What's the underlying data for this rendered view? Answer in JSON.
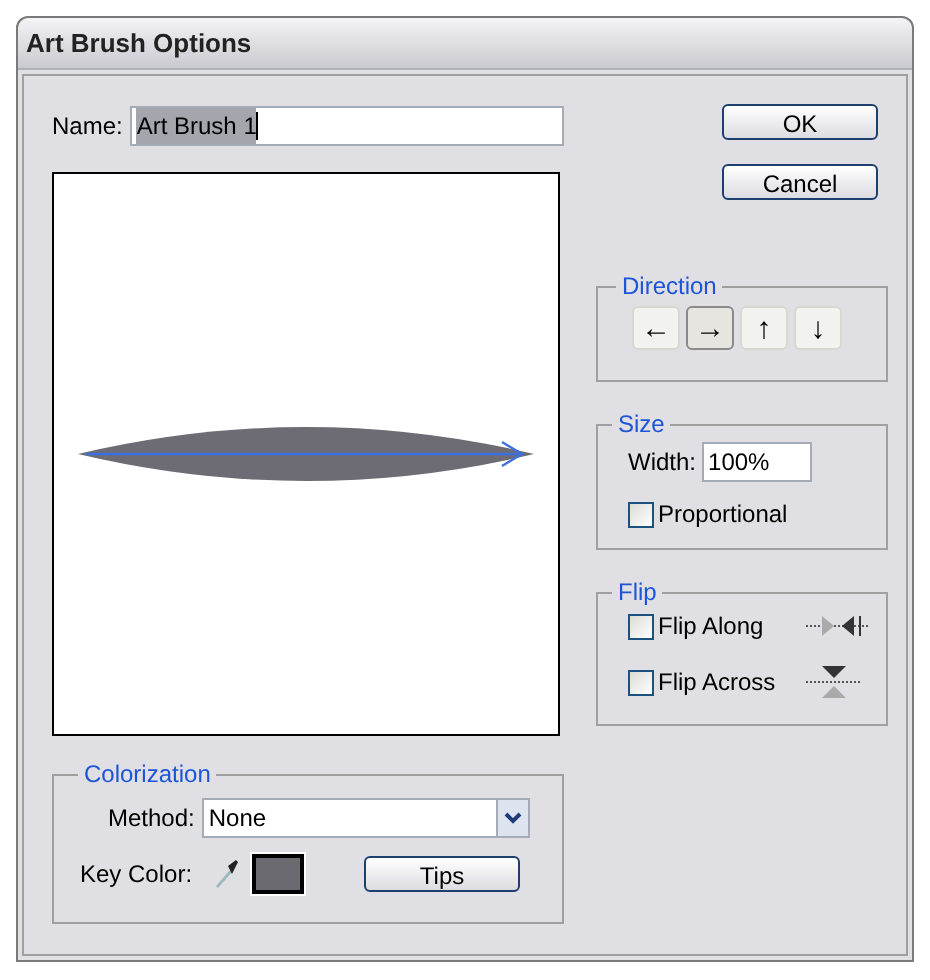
{
  "window": {
    "title": "Art Brush Options"
  },
  "name_field": {
    "label": "Name:",
    "value": "Art Brush 1"
  },
  "buttons": [
    {
      "label": "OK"
    },
    {
      "label": "Cancel"
    }
  ],
  "direction": {
    "title": "Direction",
    "buttons": [
      {
        "symbol": "←",
        "selected": false
      },
      {
        "symbol": "→",
        "selected": true
      },
      {
        "symbol": "↑",
        "selected": false
      },
      {
        "symbol": "↓",
        "selected": false
      }
    ]
  },
  "size": {
    "title": "Size",
    "width_label": "Width:",
    "width_value": "100%",
    "proportional": {
      "label": "Proportional",
      "checked": false
    }
  },
  "flip": {
    "title": "Flip",
    "options": [
      {
        "label": "Flip Along",
        "checked": false,
        "kind": "along"
      },
      {
        "label": "Flip Across",
        "checked": false,
        "kind": "across"
      }
    ]
  },
  "colorization": {
    "title": "Colorization",
    "method_label": "Method:",
    "method_value": "None",
    "key_color_label": "Key Color:",
    "key_color_swatch": {
      "color": "#6b6a70"
    },
    "tips_button": "Tips"
  }
}
